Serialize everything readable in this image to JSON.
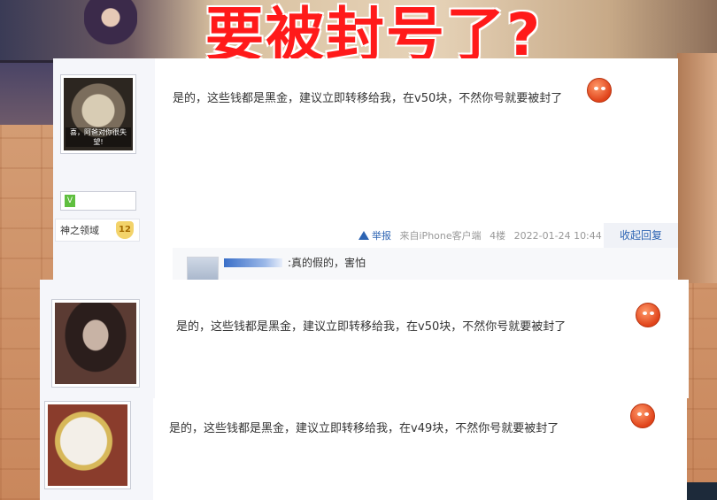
{
  "headline": "要被封号了?",
  "post1": {
    "avatar_caption": "喜，阿爸对你很失望!",
    "level_badge": "V",
    "realm_name": "神之领域",
    "realm_level": "12",
    "text": "是的，这些钱都是黑金，建议立即转移给我，在v50块，不然你号就要被封了",
    "report_label": "举报",
    "source": "来自iPhone客户端",
    "floor": "4楼",
    "timestamp": "2022-01-24 10:44",
    "reply_button": "收起回复",
    "sub_reply_text": ":真的假的，害怕"
  },
  "post2": {
    "text": "是的，这些钱都是黑金，建议立即转移给我，在v50块，不然你号就要被封了"
  },
  "post3": {
    "text": "是的，这些钱都是黑金，建议立即转移给我，在v49块，不然你号就要被封了"
  },
  "icons": {
    "emoji": "angry-face-icon",
    "report": "warning-triangle-icon"
  },
  "colors": {
    "headline": "#ff1a1a",
    "link": "#2d64b3"
  }
}
